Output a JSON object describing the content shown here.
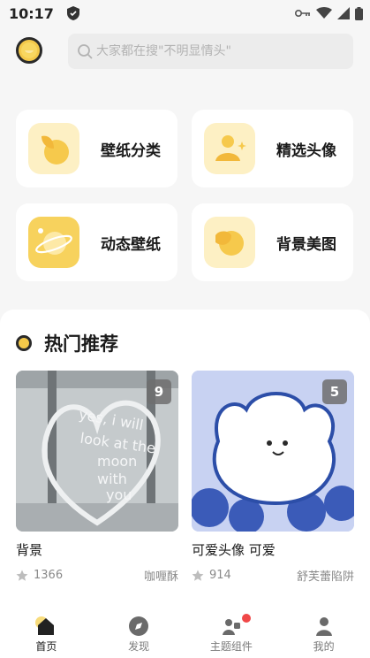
{
  "status_bar": {
    "time": "10:17"
  },
  "search": {
    "placeholder": "大家都在搜\"不明显情头\""
  },
  "categories": [
    {
      "label": "壁纸分类",
      "icon": "wallpaper-category-icon"
    },
    {
      "label": "精选头像",
      "icon": "featured-avatar-icon"
    },
    {
      "label": "动态壁纸",
      "icon": "live-wallpaper-icon"
    },
    {
      "label": "背景美图",
      "icon": "background-image-icon"
    }
  ],
  "section": {
    "title": "热门推荐"
  },
  "items": [
    {
      "title": "背景",
      "count": "9",
      "likes": "1366",
      "author": "咖喱酥"
    },
    {
      "title": "可爱头像 可爱",
      "count": "5",
      "likes": "914",
      "author": "舒芙蕾陷阱"
    }
  ],
  "tabs": [
    {
      "label": "首页",
      "icon": "home-icon",
      "active": true
    },
    {
      "label": "发现",
      "icon": "discover-icon"
    },
    {
      "label": "主题组件",
      "icon": "widgets-icon"
    },
    {
      "label": "我的",
      "icon": "profile-icon"
    }
  ],
  "colors": {
    "accent_yellow": "#f4c94a",
    "icon_bg_light": "#fdf0c4",
    "badge_red": "#f04848"
  }
}
